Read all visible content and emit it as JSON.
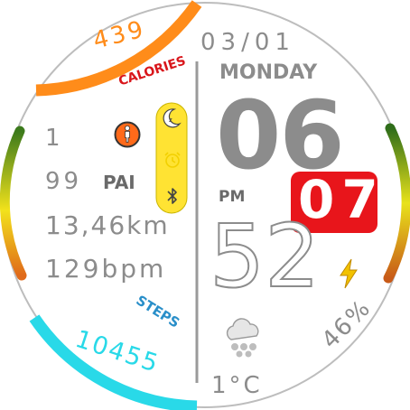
{
  "face": {
    "date": "03/01",
    "weekday": "MONDAY",
    "hour": "06",
    "ampm": "PM",
    "minute": "52",
    "seconds": "07",
    "temperature": "1°C",
    "weather_icon": "snow-cloud-icon",
    "battery": "46%",
    "battery_icon": "lightning-bolt-icon"
  },
  "calories": {
    "label": "CALORIES",
    "value": "439",
    "color": "#ff8c1a"
  },
  "steps": {
    "label": "STEPS",
    "value": "10455",
    "color": "#29d9e8"
  },
  "stats": {
    "floors": "1",
    "pai_value": "99",
    "pai_label": "PAI",
    "distance": "13,46km",
    "heart_rate": "129bpm"
  },
  "icons": {
    "activity": "walking-person-icon",
    "dnd": "moon-icon",
    "alarm": "alarm-clock-icon",
    "bluetooth": "bluetooth-icon"
  },
  "colors": {
    "accent_orange": "#ff8c1a",
    "accent_cyan": "#29d9e8",
    "seconds_red": "#e8151b",
    "status_yellow": "#ffe333",
    "text_gray": "#8c8c8c"
  }
}
